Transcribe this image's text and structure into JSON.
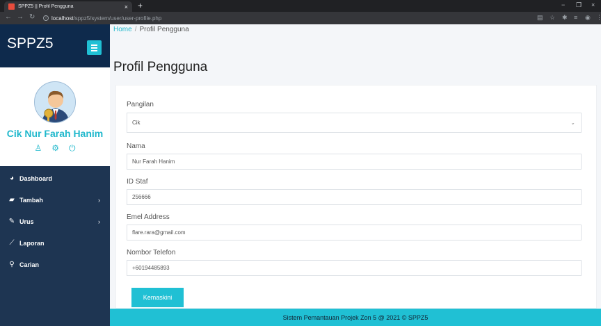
{
  "browser": {
    "tab_title": "SPPZ5 || Profil Pengguna",
    "tab_close": "×",
    "new_tab": "+",
    "url_host": "localhost",
    "url_path": "/sppz5/system/user/user-profile.php",
    "win_min": "−",
    "win_max": "❐",
    "win_close": "×"
  },
  "sidebar": {
    "brand": "SPPZ5",
    "profile_name": "Cik Nur Farah Hanim",
    "items": [
      {
        "label": "Dashboard",
        "icon": "dashboard-icon",
        "glyph": "◕",
        "has_submenu": false
      },
      {
        "label": "Tambah",
        "icon": "book-icon",
        "glyph": "▰",
        "has_submenu": true
      },
      {
        "label": "Urus",
        "icon": "edit-icon",
        "glyph": "✎",
        "has_submenu": true
      },
      {
        "label": "Laporan",
        "icon": "chart-icon",
        "glyph": "⟋",
        "has_submenu": false
      },
      {
        "label": "Carian",
        "icon": "search-icon",
        "glyph": "⚲",
        "has_submenu": false
      }
    ]
  },
  "breadcrumb": {
    "home": "Home",
    "separator": "/",
    "current": "Profil Pengguna"
  },
  "page": {
    "title": "Profil Pengguna"
  },
  "form": {
    "pangilan": {
      "label": "Pangilan",
      "value": "Cik"
    },
    "nama": {
      "label": "Nama",
      "value": "Nur Farah Hanim"
    },
    "id_staf": {
      "label": "ID Staf",
      "value": "256666"
    },
    "emel": {
      "label": "Emel Address",
      "value": "flare.rara@gmail.com"
    },
    "telefon": {
      "label": "Nombor Telefon",
      "value": "+60194485893"
    },
    "submit_label": "Kemaskini"
  },
  "footer": {
    "text": "Sistem Pemantauan Projek Zon 5 @ 2021 © SPPZ5"
  },
  "colors": {
    "accent": "#20c0d4",
    "sidebar_bg": "#1e3552",
    "brand_bg": "#0e2a4c"
  }
}
